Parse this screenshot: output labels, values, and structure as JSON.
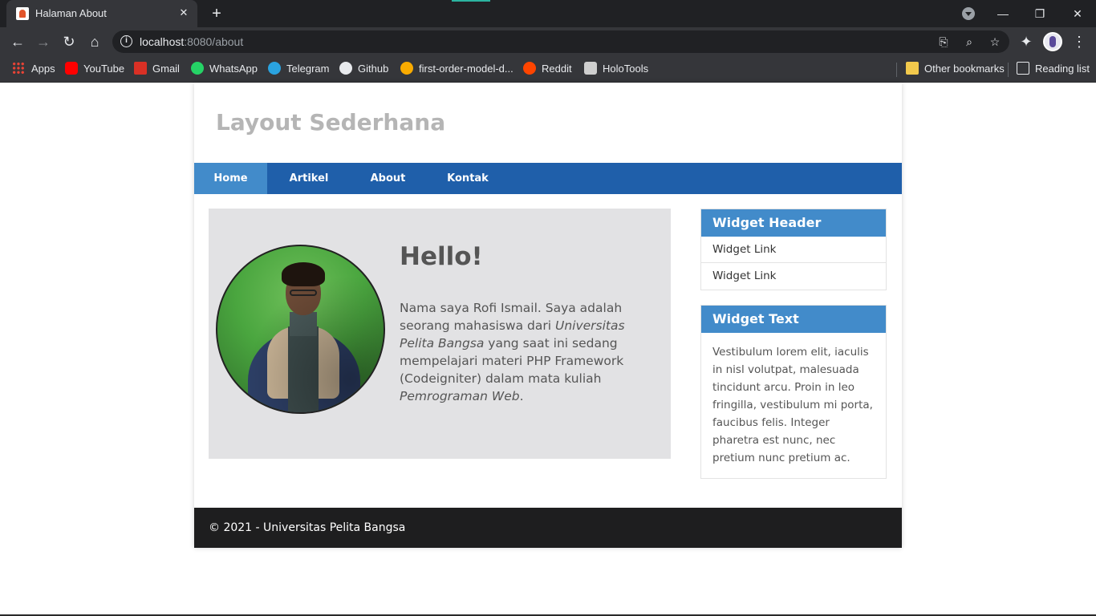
{
  "browser": {
    "tab_title": "Halaman About",
    "tab_close": "✕",
    "new_tab": "+",
    "url_host": "localhost",
    "url_rest": ":8080/about",
    "window": {
      "minimize": "—",
      "restore": "❐",
      "close": "✕"
    },
    "nav": {
      "back": "←",
      "forward": "→",
      "reload": "↻",
      "home": "⌂"
    },
    "omni_icons": {
      "translate": "⎘",
      "zoom": "⌕",
      "star": "☆",
      "extensions": "✦",
      "menu": "⋮"
    }
  },
  "bookmarks": {
    "items": [
      {
        "label": "Apps",
        "icon": "apps-grid-icon",
        "color": "#ea4335"
      },
      {
        "label": "YouTube",
        "icon": "youtube-icon",
        "color": "#ff0000"
      },
      {
        "label": "Gmail",
        "icon": "gmail-icon",
        "color": "#d93025"
      },
      {
        "label": "WhatsApp",
        "icon": "whatsapp-icon",
        "color": "#25d366"
      },
      {
        "label": "Telegram",
        "icon": "telegram-icon",
        "color": "#2aa3e0"
      },
      {
        "label": "Github",
        "icon": "github-icon",
        "color": "#e8eaed"
      },
      {
        "label": "first-order-model-d...",
        "icon": "colab-icon",
        "color": "#f9ab00"
      },
      {
        "label": "Reddit",
        "icon": "reddit-icon",
        "color": "#ff4500"
      },
      {
        "label": "HoloTools",
        "icon": "holotools-icon",
        "color": "#cfcfcf"
      }
    ],
    "other": "Other bookmarks",
    "reading": "Reading list"
  },
  "site": {
    "title": "Layout Sederhana",
    "nav": [
      "Home",
      "Artikel",
      "About",
      "Kontak"
    ],
    "active_nav": "Home",
    "hello": "Hello!",
    "bio": {
      "part1": "Nama saya Rofi Ismail. Saya adalah seorang mahasiswa dari ",
      "em1": "Universitas Pelita Bangsa",
      "part2": " yang saat ini sedang mempelajari materi PHP Framework (Codeigniter) dalam mata kuliah ",
      "em2": "Pemrograman Web",
      "part3": "."
    },
    "widget_header": {
      "title": "Widget Header",
      "links": [
        "Widget Link",
        "Widget Link"
      ]
    },
    "widget_text": {
      "title": "Widget Text",
      "body": "Vestibulum lorem elit, iaculis in nisl volutpat, malesuada tincidunt arcu. Proin in leo fringilla, vestibulum mi porta, faucibus felis. Integer pharetra est nunc, nec pretium nunc pretium ac."
    },
    "footer": "© 2021 - Universitas Pelita Bangsa",
    "colors": {
      "nav": "#1f5faa",
      "nav_active": "#428bca",
      "widget_head": "#428bca",
      "footer": "#1e1e1f"
    }
  }
}
